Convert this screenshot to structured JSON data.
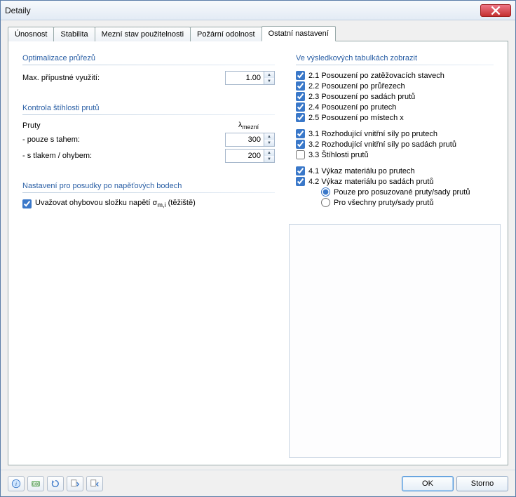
{
  "window": {
    "title": "Detaily"
  },
  "tabs": [
    {
      "label": "Únosnost"
    },
    {
      "label": "Stabilita"
    },
    {
      "label": "Mezní stav použitelnosti"
    },
    {
      "label": "Požární odolnost"
    },
    {
      "label": "Ostatní nastavení"
    }
  ],
  "left": {
    "opt": {
      "title": "Optimalizace průřezů",
      "max_label": "Max. přípustné využití:",
      "max_value": "1.00"
    },
    "slender": {
      "title": "Kontrola štíhlosti prutů",
      "header1": "Pruty",
      "header2": "λmezní",
      "row1_label": "- pouze s tahem:",
      "row1_value": "300",
      "row2_label": "- s tlakem / ohybem:",
      "row2_value": "200"
    },
    "stress": {
      "title": "Nastavení pro posudky po napěťových bodech",
      "chk_label": "Uvažovat ohybovou složku napětí σm,i (těžiště)"
    }
  },
  "right": {
    "title": "Ve výsledkových tabulkách zobrazit",
    "items": {
      "c21": "2.1 Posouzení po zatěžovacích stavech",
      "c22": "2.2 Posouzení po průřezech",
      "c23": "2.3 Posouzení po sadách prutů",
      "c24": "2.4 Posouzení po prutech",
      "c25": "2.5 Posouzení po místech x",
      "c31": "3.1 Rozhodující vnitřní síly po prutech",
      "c32": "3.2 Rozhodující vnitřní síly po sadách prutů",
      "c33": "3.3 Štíhlosti prutů",
      "c41": "4.1 Výkaz materiálu po prutech",
      "c42": "4.2 Výkaz materiálu po sadách prutů",
      "r1": "Pouze pro posuzované pruty/sady prutů",
      "r2": "Pro všechny pruty/sady prutů"
    }
  },
  "footer": {
    "ok": "OK",
    "cancel": "Storno",
    "icons": [
      "help-icon",
      "units-icon",
      "reset-icon",
      "load-default-icon",
      "save-default-icon"
    ]
  }
}
